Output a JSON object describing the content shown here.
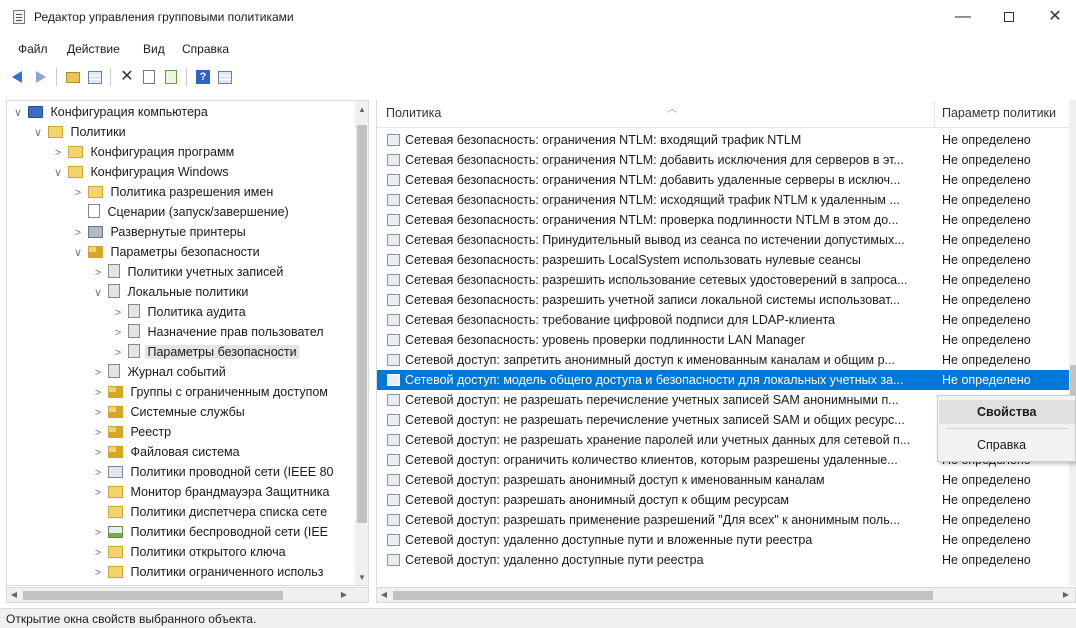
{
  "window": {
    "title": "Редактор управления групповыми политиками",
    "min": "—",
    "close": "✕"
  },
  "menu": [
    "Файл",
    "Действие",
    "Вид",
    "Справка"
  ],
  "toolbar": {
    "icons": [
      "back-arrow-icon",
      "forward-arrow-icon",
      "up-folder-icon",
      "show-hide-tree-icon",
      "delete-icon",
      "properties-icon",
      "export-list-icon",
      "help-icon",
      "view-icon"
    ]
  },
  "tree": {
    "items": [
      {
        "label": "Конфигурация компьютера",
        "exp": "∨",
        "icon": "computer"
      },
      {
        "label": "Политики",
        "exp": "∨",
        "icon": "folder"
      },
      {
        "label": "Конфигурация программ",
        "exp": ">",
        "icon": "folder"
      },
      {
        "label": "Конфигурация Windows",
        "exp": "∨",
        "icon": "folder"
      },
      {
        "label": "Политика разрешения имен",
        "exp": ">",
        "icon": "folder"
      },
      {
        "label": "Сценарии (запуск/завершение)",
        "exp": "",
        "icon": "page"
      },
      {
        "label": "Развернутые принтеры",
        "exp": ">",
        "icon": "printer"
      },
      {
        "label": "Параметры безопасности",
        "exp": "∨",
        "icon": "lockfolder"
      },
      {
        "label": "Политики учетных записей",
        "exp": ">",
        "icon": "shield"
      },
      {
        "label": "Локальные политики",
        "exp": "∨",
        "icon": "shield"
      },
      {
        "label": "Политика аудита",
        "exp": ">",
        "icon": "shield"
      },
      {
        "label": "Назначение прав пользовател",
        "exp": ">",
        "icon": "shield"
      },
      {
        "label": "Параметры безопасности",
        "exp": ">",
        "icon": "shield"
      },
      {
        "label": "Журнал событий",
        "exp": ">",
        "icon": "shield"
      },
      {
        "label": "Группы с ограниченным доступом",
        "exp": ">",
        "icon": "lockfolder"
      },
      {
        "label": "Системные службы",
        "exp": ">",
        "icon": "lockfolder"
      },
      {
        "label": "Реестр",
        "exp": ">",
        "icon": "lockfolder"
      },
      {
        "label": "Файловая система",
        "exp": ">",
        "icon": "lockfolder"
      },
      {
        "label": "Политики проводной сети (IEEE 80",
        "exp": ">",
        "icon": "network"
      },
      {
        "label": "Монитор брандмауэра Защитника",
        "exp": ">",
        "icon": "folder"
      },
      {
        "label": "Политики диспетчера списка сете",
        "exp": "",
        "icon": "folder"
      },
      {
        "label": "Политики беспроводной сети (IEE",
        "exp": ">",
        "icon": "wifi"
      },
      {
        "label": "Политики открытого ключа",
        "exp": ">",
        "icon": "folder"
      },
      {
        "label": "Политики ограниченного использ",
        "exp": ">",
        "icon": "folder"
      }
    ]
  },
  "list": {
    "columns": [
      "Политика",
      "Параметр политики"
    ],
    "rows": [
      {
        "name": "Сетевая безопасность: ограничения NTLM: входящий трафик NTLM",
        "value": "Не определено"
      },
      {
        "name": "Сетевая безопасность: ограничения NTLM: добавить исключения для серверов в эт...",
        "value": "Не определено"
      },
      {
        "name": "Сетевая безопасность: ограничения NTLM: добавить удаленные серверы в исключ...",
        "value": "Не определено"
      },
      {
        "name": "Сетевая безопасность: ограничения NTLM: исходящий трафик NTLM к удаленным ...",
        "value": "Не определено"
      },
      {
        "name": "Сетевая безопасность: ограничения NTLM: проверка подлинности NTLM в этом до...",
        "value": "Не определено"
      },
      {
        "name": "Сетевая безопасность: Принудительный вывод из сеанса по истечении допустимых...",
        "value": "Не определено"
      },
      {
        "name": "Сетевая безопасность: разрешить LocalSystem использовать нулевые сеансы",
        "value": "Не определено"
      },
      {
        "name": "Сетевая безопасность: разрешить использование сетевых удостоверений в запроса...",
        "value": "Не определено"
      },
      {
        "name": "Сетевая безопасность: разрешить учетной записи локальной системы использоват...",
        "value": "Не определено"
      },
      {
        "name": "Сетевая безопасность: требование цифровой подписи для LDAP-клиента",
        "value": "Не определено"
      },
      {
        "name": "Сетевая безопасность: уровень проверки подлинности LAN Manager",
        "value": "Не определено"
      },
      {
        "name": "Сетевой доступ: запретить анонимный доступ к именованным каналам и общим р...",
        "value": "Не определено"
      },
      {
        "name": "Сетевой доступ: модель общего доступа и безопасности для локальных учетных за...",
        "value": "Не определено"
      },
      {
        "name": "Сетевой доступ: не разрешать перечисление учетных записей SAM анонимными п...",
        "value": ""
      },
      {
        "name": "Сетевой доступ: не разрешать перечисление учетных записей SAM и общих ресурс...",
        "value": ""
      },
      {
        "name": "Сетевой доступ: не разрешать хранение паролей или учетных данных для сетевой п...",
        "value": ""
      },
      {
        "name": "Сетевой доступ: ограничить количество клиентов, которым разрешены удаленные...",
        "value": "Не определено"
      },
      {
        "name": "Сетевой доступ: разрешать анонимный доступ к именованным каналам",
        "value": "Не определено"
      },
      {
        "name": "Сетевой доступ: разрешать анонимный доступ к общим ресурсам",
        "value": "Не определено"
      },
      {
        "name": "Сетевой доступ: разрешать применение разрешений \"Для всех\" к анонимным поль...",
        "value": "Не определено"
      },
      {
        "name": "Сетевой доступ: удаленно доступные пути и вложенные пути реестра",
        "value": "Не определено"
      },
      {
        "name": "Сетевой доступ: удаленно доступные пути реестра",
        "value": "Не определено"
      }
    ]
  },
  "context_menu": {
    "properties": "Свойства",
    "help": "Справка"
  },
  "status": "Открытие окна свойств выбранного объекта."
}
